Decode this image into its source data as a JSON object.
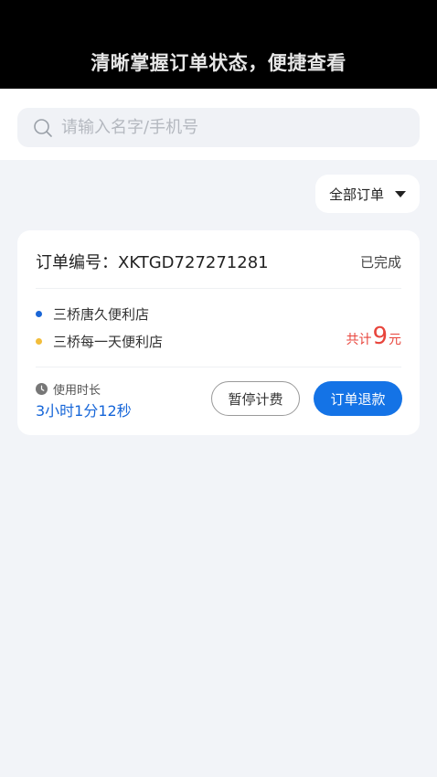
{
  "banner": {
    "text": "清晰掌握订单状态，便捷查看"
  },
  "search": {
    "placeholder": "请输入名字/手机号"
  },
  "filter": {
    "label": "全部订单"
  },
  "order": {
    "number_label": "订单编号：XKTGD727271281",
    "status": "已完成",
    "stores": [
      {
        "name": "三桥唐久便利店",
        "dot_color": "#1a66d6"
      },
      {
        "name": "三桥每一天便利店",
        "dot_color": "#f2bd3b"
      }
    ],
    "total": {
      "label": "共计",
      "amount": "9",
      "unit": "元"
    },
    "duration": {
      "label": "使用时长",
      "value": "3小时1分12秒"
    },
    "actions": {
      "pause": "暂停计费",
      "refund": "订单退款"
    }
  },
  "colors": {
    "accent": "#1473e6",
    "price": "#e8453c",
    "background": "#f2f4f8"
  }
}
